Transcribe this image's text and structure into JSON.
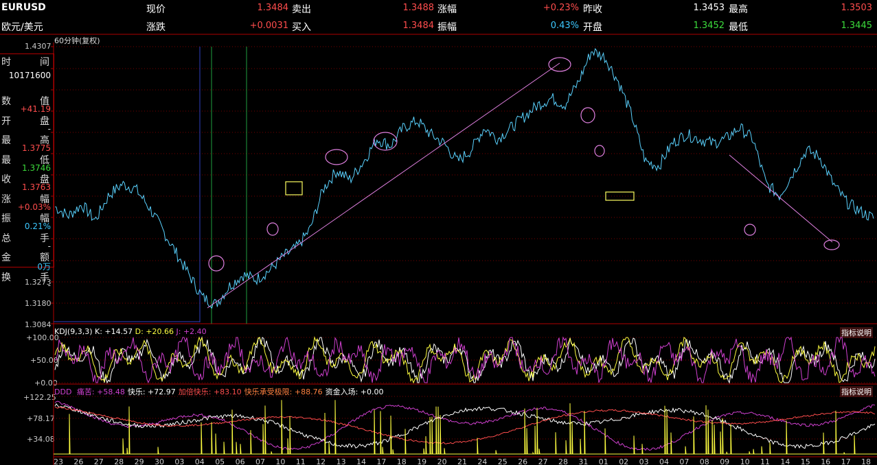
{
  "header": {
    "symbol": "EURUSD",
    "name": "欧元/美元",
    "row1": [
      {
        "label": "现价",
        "value": "1.3484",
        "color": "#ff4d4d"
      },
      {
        "label": "卖出",
        "value": "1.3488",
        "color": "#ff4d4d"
      },
      {
        "label": "涨幅",
        "value": "+0.23%",
        "color": "#ff4d4d"
      },
      {
        "label": "昨收",
        "value": "1.3453",
        "color": "#ffffff"
      },
      {
        "label": "最高",
        "value": "1.3503",
        "color": "#ff4d4d"
      }
    ],
    "row2": [
      {
        "label": "涨跌",
        "value": "+0.0031",
        "color": "#ff4d4d"
      },
      {
        "label": "买入",
        "value": "1.3484",
        "color": "#ff4d4d"
      },
      {
        "label": "振幅",
        "value": "0.43%",
        "color": "#3cc8ff"
      },
      {
        "label": "开盘",
        "value": "1.3452",
        "color": "#3cdc3c"
      },
      {
        "label": "最低",
        "value": "1.3445",
        "color": "#3cdc3c"
      }
    ]
  },
  "main_chart": {
    "period_label": "60分钟(复权)",
    "y_top_label": "1.4307",
    "y_ticks": [
      "1.3273",
      "1.3180",
      "1.3084"
    ]
  },
  "side_panel": {
    "rows": [
      {
        "k": "时",
        "k2": "间",
        "v": ""
      },
      {
        "k": "",
        "k2": "",
        "v": "10171600",
        "color": "#ffffff"
      },
      {
        "k": "数",
        "k2": "值",
        "v": "+41.19",
        "color": "#ff4d4d"
      },
      {
        "k": "开",
        "k2": "盘",
        "v": "-",
        "color": "#dddddd"
      },
      {
        "k": "最",
        "k2": "高",
        "v": "1.3775",
        "color": "#ff4d4d"
      },
      {
        "k": "最",
        "k2": "低",
        "v": "1.3746",
        "color": "#3cdc3c"
      },
      {
        "k": "收",
        "k2": "盘",
        "v": "1.3763",
        "color": "#ff4d4d"
      },
      {
        "k": "涨",
        "k2": "幅",
        "v": "+0.03%",
        "color": "#ff4d4d"
      },
      {
        "k": "振",
        "k2": "幅",
        "v": "0.21%",
        "color": "#3cc8ff"
      },
      {
        "k": "总",
        "k2": "手",
        "v": "-",
        "color": "#dddddd"
      },
      {
        "k": "金",
        "k2": "额",
        "v": "0万",
        "color": "#3cc8ff"
      },
      {
        "k": "换",
        "k2": "手",
        "v": "-",
        "color": "#dddddd"
      }
    ]
  },
  "kdj": {
    "title": "KDJ(9,3,3)",
    "k": "K: +14.57",
    "d": "D: +20.66",
    "j": "J: +2.40",
    "y_ticks": [
      "+100.00",
      "+50.00",
      "+0.00"
    ],
    "explain": "指标说明"
  },
  "ddd": {
    "title": "DDD",
    "items": [
      {
        "text": "痛苦: +58.48",
        "color": "#d040d0"
      },
      {
        "text": "快乐: +72.97",
        "color": "#ffffff"
      },
      {
        "text": "加倍快乐: +83.10",
        "color": "#ff4d4d"
      },
      {
        "text": "快乐承受极限: +88.76",
        "color": "#ff8040"
      },
      {
        "text": "资金入场: +0.00",
        "color": "#ffffff"
      }
    ],
    "y_ticks": [
      "+122.25",
      "+78.17",
      "+34.08"
    ],
    "explain": "指标说明"
  },
  "x_axis": {
    "labels": [
      "23",
      "26",
      "27",
      "28",
      "29",
      "30",
      "03",
      "04",
      "05",
      "06",
      "07",
      "10",
      "11",
      "12",
      "13",
      "14",
      "17",
      "18",
      "19",
      "20",
      "21",
      "24",
      "25",
      "26",
      "27",
      "28",
      "31",
      "01",
      "02",
      "03",
      "04",
      "07",
      "08",
      "09",
      "10",
      "11",
      "14",
      "15",
      "16",
      "17",
      "18"
    ]
  },
  "chart_data": {
    "type": "line",
    "series": [
      {
        "values": [
          1.36,
          1.356,
          1.361,
          1.354,
          1.365,
          1.37,
          1.368,
          1.36,
          1.35,
          1.34,
          1.33,
          1.32,
          1.317,
          1.325,
          1.33,
          1.328,
          1.332,
          1.338,
          1.342,
          1.35,
          1.368,
          1.376,
          1.372,
          1.38,
          1.39,
          1.387,
          1.395,
          1.398,
          1.392,
          1.388,
          1.38,
          1.385,
          1.395,
          1.39,
          1.395,
          1.4,
          1.405,
          1.408,
          1.405,
          1.415,
          1.429,
          1.426,
          1.415,
          1.4,
          1.38,
          1.378,
          1.388,
          1.392,
          1.39,
          1.388,
          1.39,
          1.395,
          1.39,
          1.37,
          1.365,
          1.375,
          1.385,
          1.382,
          1.37,
          1.362,
          1.358,
          1.355
        ]
      }
    ]
  }
}
